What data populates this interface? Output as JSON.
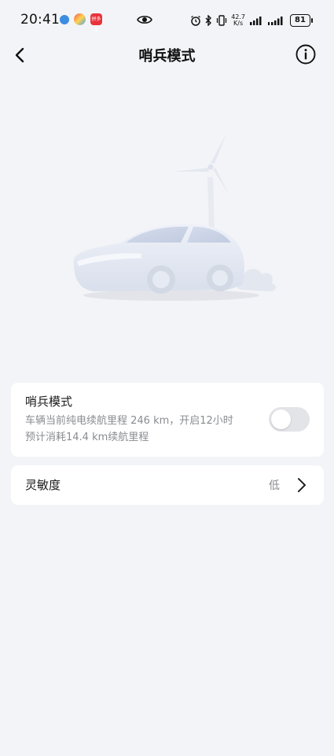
{
  "status_bar": {
    "time": "20:41",
    "net_speed_value": "42.7",
    "net_speed_unit": "K/s",
    "battery": "81",
    "app3_label": "拼多多"
  },
  "header": {
    "title": "哨兵模式",
    "back_icon": "chevron-left-icon",
    "info_icon": "info-circle-icon"
  },
  "sentry_card": {
    "title": "哨兵模式",
    "description_line1": "车辆当前纯电续航里程 246 km，开启12小时",
    "description_line2": "预计消耗14.4 km续航里程",
    "toggle_on": false
  },
  "sensitivity_card": {
    "label": "灵敏度",
    "value": "低",
    "chevron_icon": "chevron-right-icon"
  },
  "colors": {
    "background": "#f3f4f7",
    "card": "#ffffff",
    "secondary_text": "#8a8c91",
    "toggle_off": "#e3e4e8"
  }
}
